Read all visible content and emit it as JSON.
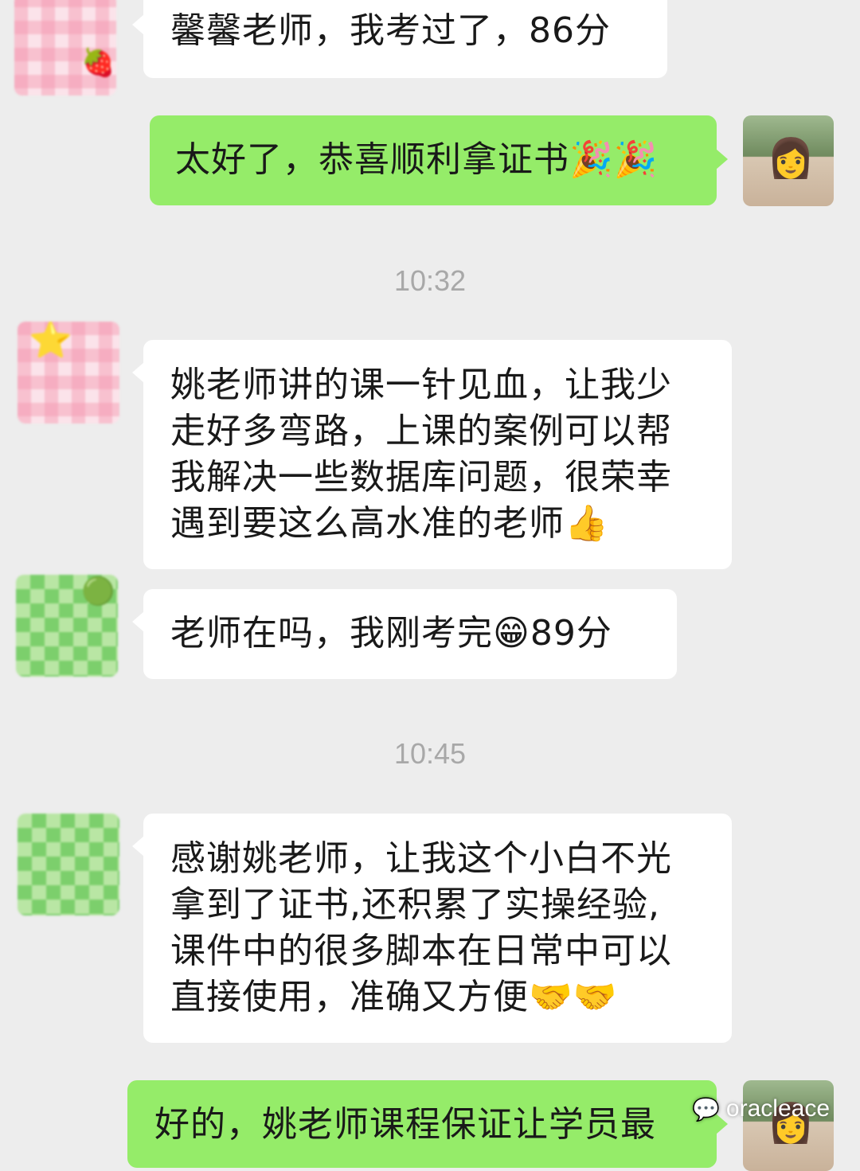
{
  "chat": {
    "messages": [
      {
        "side": "left",
        "text": "馨馨老师，我考过了，86分"
      },
      {
        "side": "right",
        "text": "太好了，恭喜顺利拿证书🎉🎉"
      },
      {
        "side": "left",
        "text": "姚老师讲的课一针见血，让我少\n走好多弯路，上课的案例可以帮\n我解决一些数据库问题，很荣幸\n遇到要这么高水准的老师👍"
      },
      {
        "side": "left",
        "text": "老师在吗，我刚考完😁89分"
      },
      {
        "side": "left",
        "text": "感谢姚老师，让我这个小白不光\n拿到了证书,还积累了实操经验,\n课件中的很多脚本在日常中可以\n直接使用，准确又方便🤝🤝"
      },
      {
        "side": "right",
        "text": "好的，姚老师课程保证让学员最"
      }
    ],
    "timestamps": [
      "10:32",
      "10:45"
    ],
    "watermark": "oracleace",
    "colors": {
      "background": "#ededed",
      "incoming_bubble": "#ffffff",
      "outgoing_bubble": "#95ec69",
      "timestamp": "#a8a8a8"
    },
    "icons": [
      "wechat-icon",
      "strawberry-avatar-icon",
      "star-avatar-icon",
      "checker-avatar-icon"
    ]
  }
}
